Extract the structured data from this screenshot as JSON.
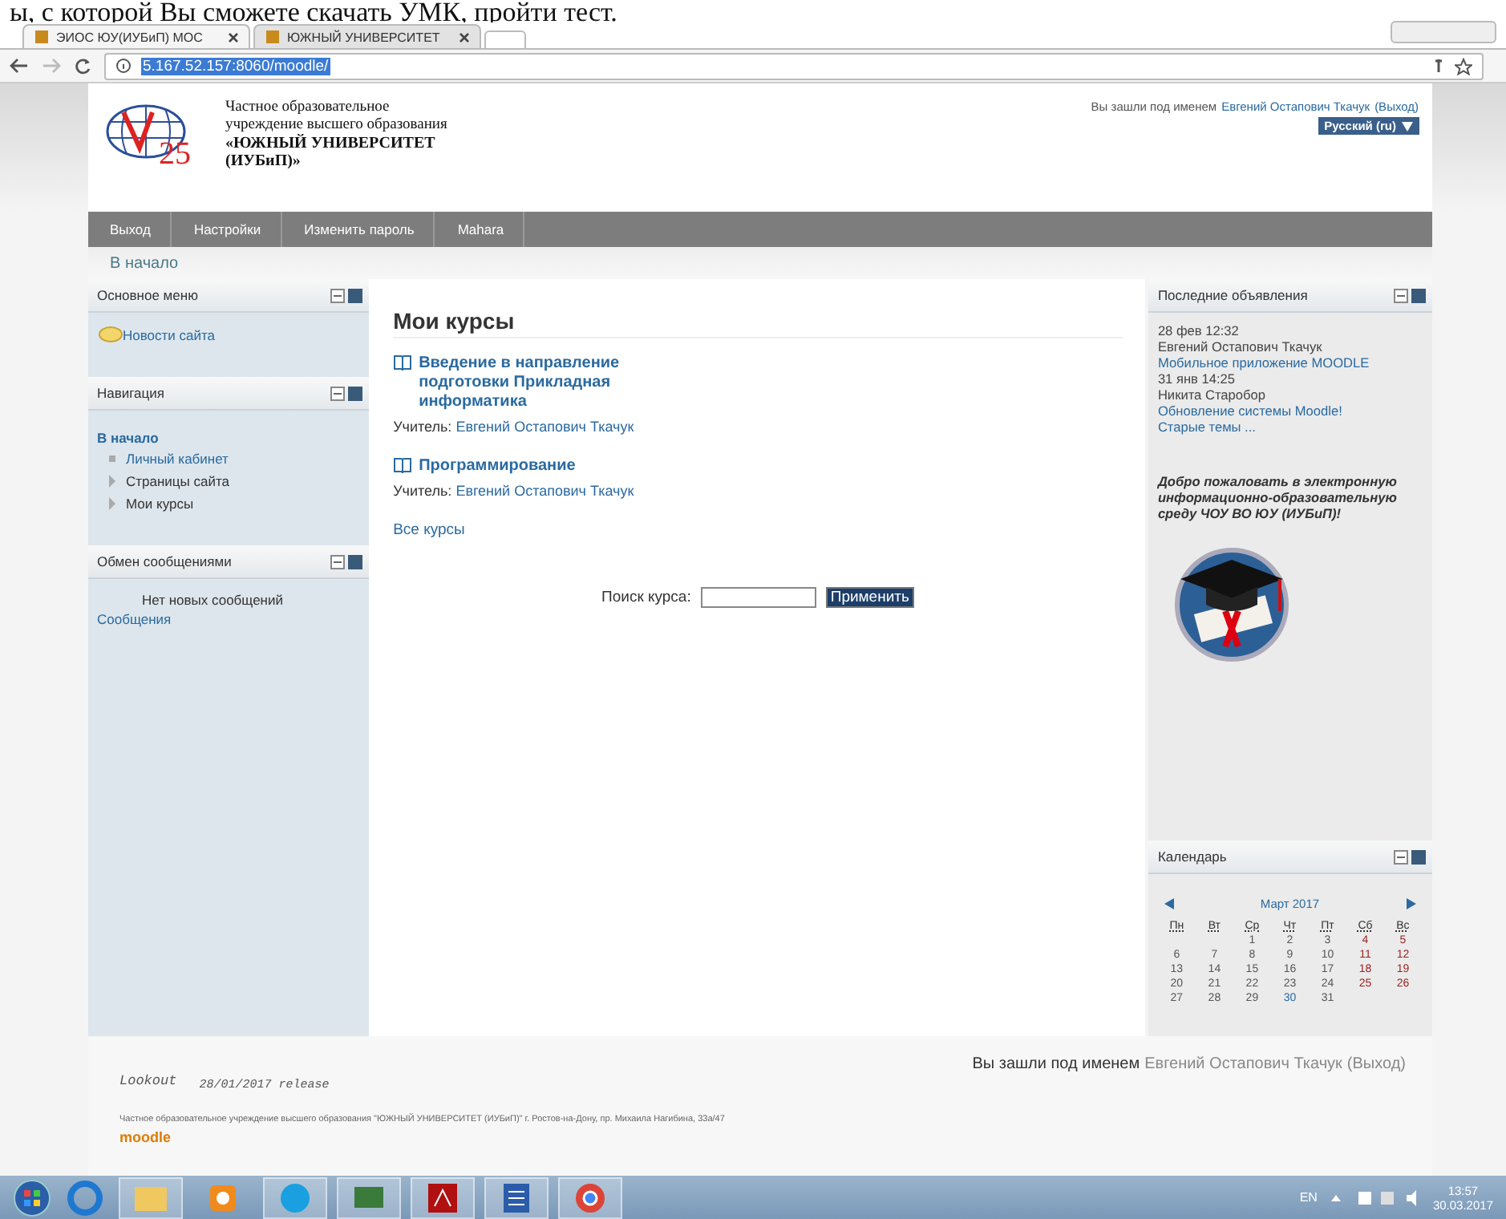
{
  "doc_text": "ы, с которой Вы сможете скачать УМК, пройти тест.",
  "browser": {
    "tabs": [
      {
        "label": "ЭИОС ЮУ(ИУБиП) МОС",
        "selected": true
      },
      {
        "label": "ЮЖНЫЙ УНИВЕРСИТЕТ",
        "selected": false
      }
    ],
    "url": "5.167.52.157:8060/moodle/"
  },
  "header": {
    "logo_text": "25",
    "org_lines": [
      "Частное образовательное",
      "учреждение высшего образования",
      "«ЮЖНЫЙ УНИВЕРСИТЕТ",
      "(ИУБиП)»"
    ],
    "login": {
      "prefix": "Вы зашли под именем",
      "user": "Евгений Остапович Ткачук",
      "logout": "(Выход)"
    },
    "language": "Русский (ru)"
  },
  "nav": [
    "Выход",
    "Настройки",
    "Изменить пароль",
    "Mahara"
  ],
  "breadcrumb": "В начало",
  "main_menu": {
    "title": "Основное меню",
    "items": [
      "Новости сайта"
    ]
  },
  "navigation": {
    "title": "Навигация",
    "home": "В начало",
    "items": [
      {
        "label": "Личный кабинет",
        "kind": "leaf"
      },
      {
        "label": "Страницы сайта",
        "kind": "branch"
      },
      {
        "label": "Мои курсы",
        "kind": "branch"
      }
    ]
  },
  "messages": {
    "title": "Обмен сообщениями",
    "text": "Нет новых сообщений",
    "link": "Сообщения"
  },
  "content": {
    "title": "Мои курсы",
    "courses": [
      {
        "name": "Введение в направление подготовки Прикладная информатика",
        "teacher_label": "Учитель:",
        "teacher": "Евгений Остапович Ткачук"
      },
      {
        "name": "Программирование",
        "teacher_label": "Учитель:",
        "teacher": "Евгений Остапович Ткачук"
      }
    ],
    "all_courses": "Все курсы",
    "search": {
      "label": "Поиск курса:",
      "button": "Применить"
    }
  },
  "news": {
    "title": "Последние объявления",
    "items": [
      {
        "date": "28 фев 12:32",
        "author": "Евгений Остапович Ткачук",
        "subject": "Мобильное приложение MOODLE"
      },
      {
        "date": "31 янв 14:25",
        "author": "Никита Старобор",
        "subject": "Обновление системы Moodle!"
      }
    ],
    "more": "Старые темы ..."
  },
  "welcome": "Добро пожаловать в электронную информационно-образовательную среду ЧОУ ВО ЮУ (ИУБиП)!",
  "calendar": {
    "title": "Календарь",
    "month": "Март 2017",
    "weekdays": [
      "Пн",
      "Вт",
      "Ср",
      "Чт",
      "Пт",
      "Сб",
      "Вс"
    ],
    "weeks": [
      [
        {
          "day": "1",
          "kind": "normal"
        },
        {
          "day": "2",
          "kind": "normal"
        },
        {
          "day": "3",
          "kind": "normal"
        },
        {
          "day": "4",
          "kind": "weekend"
        },
        {
          "day": "5",
          "kind": "weekend"
        }
      ],
      [
        {
          "day": "6",
          "kind": "normal"
        },
        {
          "day": "7",
          "kind": "normal"
        },
        {
          "day": "8",
          "kind": "normal"
        },
        {
          "day": "9",
          "kind": "normal"
        },
        {
          "day": "10",
          "kind": "normal"
        },
        {
          "day": "11",
          "kind": "weekend"
        },
        {
          "day": "12",
          "kind": "weekend"
        }
      ],
      [
        {
          "day": "13",
          "kind": "normal"
        },
        {
          "day": "14",
          "kind": "normal"
        },
        {
          "day": "15",
          "kind": "normal"
        },
        {
          "day": "16",
          "kind": "normal"
        },
        {
          "day": "17",
          "kind": "normal"
        },
        {
          "day": "18",
          "kind": "weekend"
        },
        {
          "day": "19",
          "kind": "weekend"
        }
      ],
      [
        {
          "day": "20",
          "kind": "normal"
        },
        {
          "day": "21",
          "kind": "normal"
        },
        {
          "day": "22",
          "kind": "normal"
        },
        {
          "day": "23",
          "kind": "normal"
        },
        {
          "day": "24",
          "kind": "normal"
        },
        {
          "day": "25",
          "kind": "weekend"
        },
        {
          "day": "26",
          "kind": "weekend"
        }
      ],
      [
        {
          "day": "27",
          "kind": "normal"
        },
        {
          "day": "28",
          "kind": "normal"
        },
        {
          "day": "29",
          "kind": "normal"
        },
        {
          "day": "30",
          "kind": "today"
        },
        {
          "day": "31",
          "kind": "normal"
        }
      ]
    ]
  },
  "footer": {
    "login": {
      "prefix": "Вы зашли под именем",
      "user": "Евгений Остапович Ткачук",
      "logout": "(Выход)"
    },
    "theme": "Lookout",
    "release": "28/01/2017 release",
    "address": "Частное образовательное учреждение высшего образования \"ЮЖНЫЙ УНИВЕРСИТЕТ (ИУБиП)\" г. Ростов-на-Дону, пр. Михаила Нагибина, 33а/47",
    "brand": "moodle"
  },
  "taskbar": {
    "lang": "EN",
    "time": "13:57",
    "date": "30.03.2017"
  }
}
